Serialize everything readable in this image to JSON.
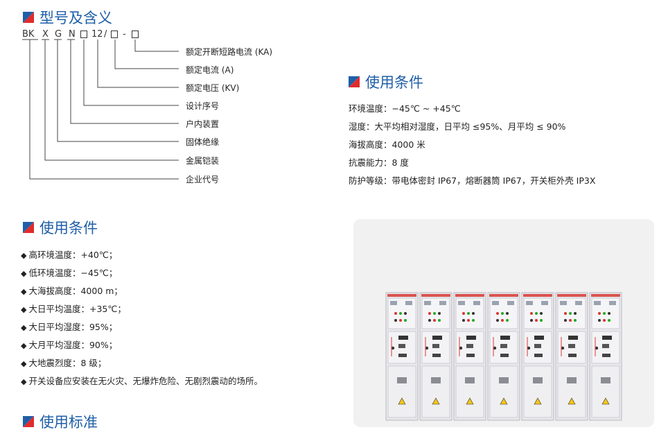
{
  "section_model": {
    "title": "型号及含义"
  },
  "model_code": {
    "letters": [
      "BK",
      "X",
      "G",
      "N",
      "12",
      "/",
      "-"
    ],
    "legend": [
      "额定开断短路电流 (KA)",
      "额定电流 (A)",
      "额定电压 (KV)",
      "设计序号",
      "户内装置",
      "固体绝缘",
      "金属铠装",
      "企业代号"
    ]
  },
  "section_conditions": {
    "title": "使用条件",
    "items": [
      "环境温度：−45℃ ~ +45℃",
      "湿度：大平均相对湿度，日平均 ≤95%、月平均 ≤ 90%",
      "海拔高度：4000 米",
      "抗震能力：8 度",
      "防护等级：带电体密封 IP67，熔断器筒 IP67，开关柜外壳 IP3X"
    ]
  },
  "section_conditions2": {
    "title": "使用条件",
    "bullets": [
      "高环境温度：+40℃；",
      "低环境温度：−45℃；",
      "大海拔高度：4000 m；",
      "大日平均温度：+35℃；",
      "大日平均湿度：95%；",
      "大月平均湿度：90%；",
      "大地震烈度：8 级；",
      "开关设备应安装在无火灾、无爆炸危险、无剧烈震动的场所。"
    ]
  },
  "section_standard": {
    "title": "使用标准"
  },
  "icons": {
    "section_flag": "flag-icon",
    "bullet": "diamond-icon"
  },
  "colors": {
    "heading": "#1f5fa8",
    "flag_red": "#e02b2b",
    "flag_blue": "#1f5fa8"
  },
  "panel_count": 7
}
